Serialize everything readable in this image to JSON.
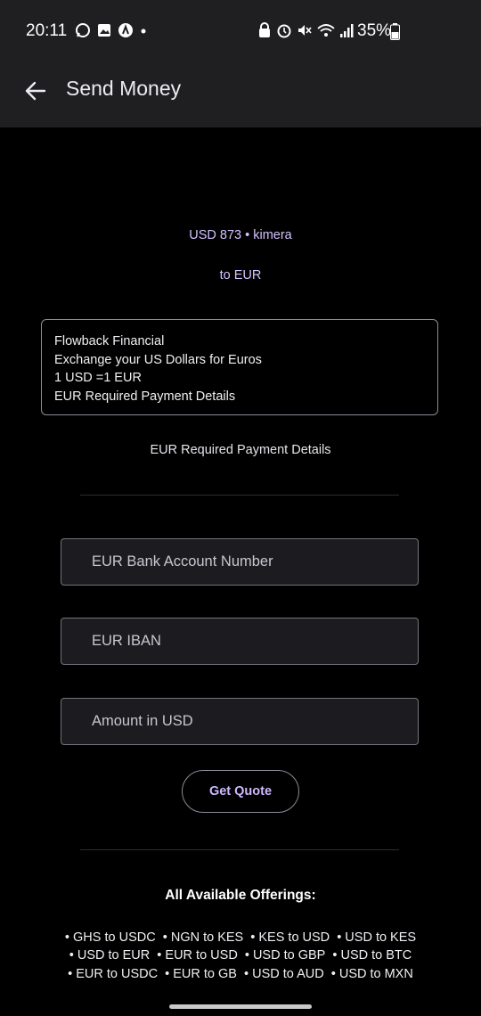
{
  "status": {
    "time": "20:11",
    "battery": "35%",
    "left_icons": [
      "whatsapp-icon",
      "image-icon",
      "app-icon",
      "dot-icon"
    ],
    "right_icons": [
      "lock-icon",
      "alarm-icon",
      "mute-icon",
      "wifi-icon",
      "signal-icon"
    ]
  },
  "appbar": {
    "title": "Send Money",
    "back_icon": "arrow-left-icon"
  },
  "transfer": {
    "from_line": "USD  873 • kimera",
    "to_line": "to EUR"
  },
  "provider": {
    "name": "Flowback Financial",
    "description": "Exchange your US Dollars for Euros",
    "rate": "1 USD =1 EUR",
    "requirement": "EUR Required Payment Details"
  },
  "form": {
    "section_label": "EUR Required Payment Details",
    "account_placeholder": "EUR Bank Account Number",
    "iban_placeholder": "EUR IBAN",
    "amount_placeholder": "Amount in USD",
    "quote_button": "Get Quote"
  },
  "offerings": {
    "title": "All Available Offerings:",
    "rows": [
      [
        "GHS to USDC",
        "NGN to KES",
        "KES to USD",
        "USD to KES"
      ],
      [
        "USD to EUR",
        "EUR to USD",
        "USD to GBP",
        "USD to BTC"
      ],
      [
        "EUR to USDC",
        "EUR to GB",
        "USD to AUD",
        "USD to MXN"
      ]
    ]
  },
  "colors": {
    "background": "#000000",
    "appbar": "#1f1f21",
    "accent": "#cdb8ff"
  }
}
